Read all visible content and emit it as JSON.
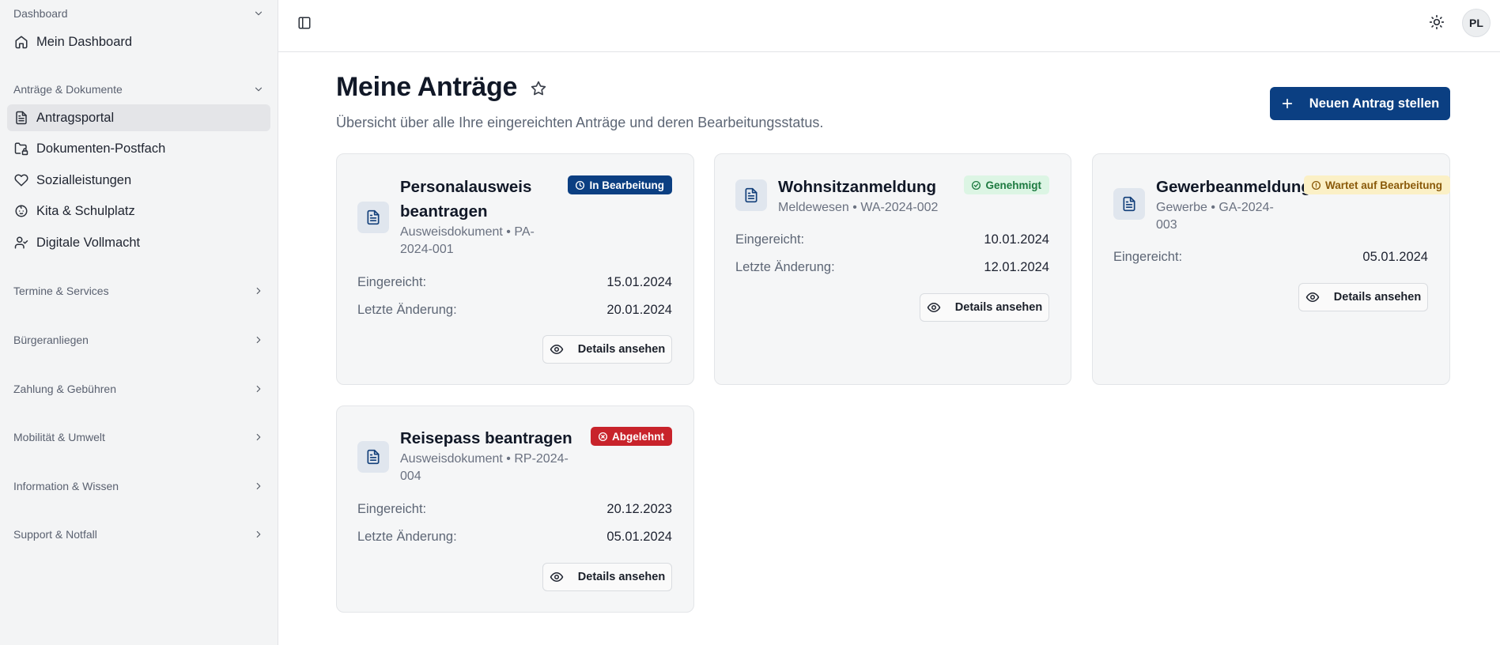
{
  "sidebar": {
    "groups": [
      {
        "label": "Dashboard",
        "expanded": true
      },
      {
        "label": "Anträge & Dokumente",
        "expanded": true
      },
      {
        "label": "Termine & Services",
        "expanded": false
      },
      {
        "label": "Bürgeranliegen",
        "expanded": false
      },
      {
        "label": "Zahlung & Gebühren",
        "expanded": false
      },
      {
        "label": "Mobilität & Umwelt",
        "expanded": false
      },
      {
        "label": "Information & Wissen",
        "expanded": false
      },
      {
        "label": "Support & Notfall",
        "expanded": false
      }
    ],
    "items": [
      {
        "label": "Mein Dashboard",
        "icon": "home-icon"
      },
      {
        "label": "Antragsportal",
        "icon": "file-text-icon",
        "active": true
      },
      {
        "label": "Dokumenten-Postfach",
        "icon": "folder-lock-icon"
      },
      {
        "label": "Sozialleistungen",
        "icon": "heart-icon"
      },
      {
        "label": "Kita & Schulplatz",
        "icon": "baby-icon"
      },
      {
        "label": "Digitale Vollmacht",
        "icon": "user-check-icon"
      }
    ]
  },
  "header": {
    "avatar_initials": "PL"
  },
  "main": {
    "title": "Meine Anträge",
    "subtitle": "Übersicht über alle Ihre eingereichten Anträge und deren Bearbeitungsstatus.",
    "new_button": "Neuen Antrag stellen",
    "submitted_label": "Eingereicht:",
    "changed_label": "Letzte Änderung:",
    "details_label": "Details ansehen",
    "cards": [
      {
        "title_line1": "Personalausweis",
        "title_line2": "beantragen",
        "sub_line1": "Ausweisdokument • PA-",
        "sub_line2": "2024-001",
        "status": "In Bearbeitung",
        "status_color": "#0b3f82",
        "submitted": "15.01.2024",
        "changed": "20.01.2024"
      },
      {
        "title_line1": "Wohnsitzanmeldung",
        "sub_line1": "Meldewesen • WA-2024-002",
        "status": "Genehmigt",
        "status_color": "#1d7a40",
        "submitted": "10.01.2024",
        "changed": "12.01.2024"
      },
      {
        "title_line1": "Gewerbeanmeldung",
        "sub_line1": "Gewerbe • GA-2024-",
        "sub_line2": "003",
        "status": "Wartet auf Bearbeitung",
        "status_color": "#8a5a0a",
        "submitted": "05.01.2024"
      },
      {
        "title_line1": "Reisepass beantragen",
        "sub_line1": "Ausweisdokument • RP-2024-",
        "sub_line2": "004",
        "status": "Abgelehnt",
        "status_color": "#c8232b",
        "submitted": "20.12.2023",
        "changed": "05.01.2024"
      }
    ]
  }
}
